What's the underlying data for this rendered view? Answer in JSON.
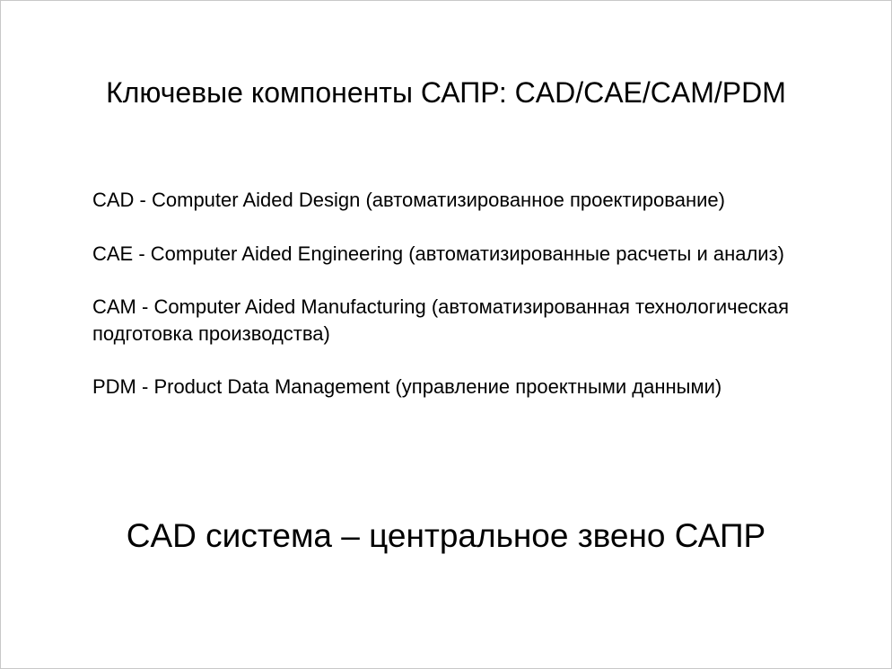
{
  "slide": {
    "title": "Ключевые компоненты САПР: CAD/CAE/CAM/PDM",
    "items": [
      "CAD - Computer Aided Design (автоматизированное проектирование)",
      "CAE - Computer Aided Engineering (автоматизированные расчеты и анализ)",
      "CAM - Computer Aided Manufacturing (автоматизированная технологическая подготовка производства)",
      "PDM - Product Data Management (управление проектными данными)"
    ],
    "conclusion": "CAD система – центральное звено САПР"
  }
}
